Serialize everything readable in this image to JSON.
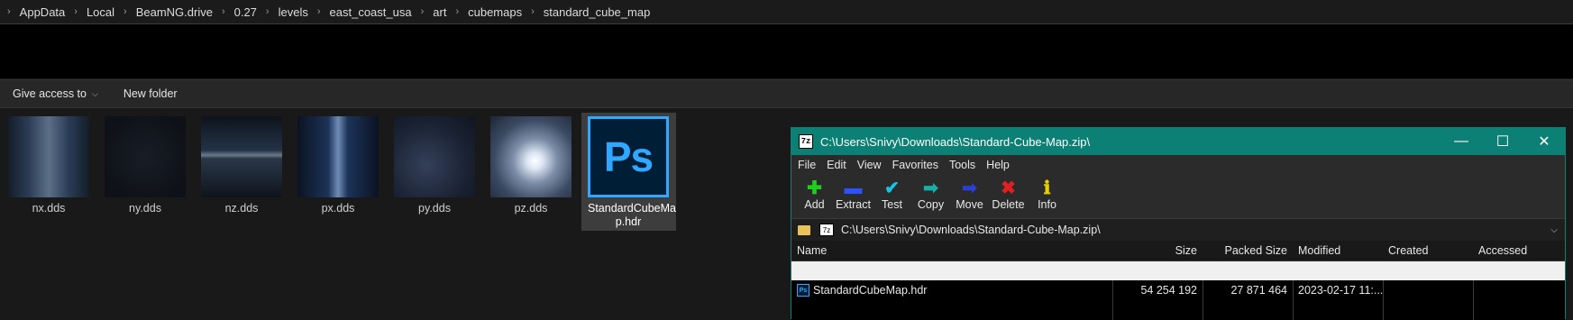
{
  "breadcrumb": [
    "AppData",
    "Local",
    "BeamNG.drive",
    "0.27",
    "levels",
    "east_coast_usa",
    "art",
    "cubemaps",
    "standard_cube_map"
  ],
  "toolbar": {
    "give_access": "Give access to",
    "new_folder": "New folder"
  },
  "files": [
    {
      "name": "nx.dds"
    },
    {
      "name": "ny.dds"
    },
    {
      "name": "nz.dds"
    },
    {
      "name": "px.dds"
    },
    {
      "name": "py.dds"
    },
    {
      "name": "pz.dds"
    }
  ],
  "hdr_file": {
    "name": "StandardCubeMa p.hdr",
    "icon_text": "Ps"
  },
  "sevenzip": {
    "title": "C:\\Users\\Snivy\\Downloads\\Standard-Cube-Map.zip\\",
    "icon_text": "7z",
    "window_buttons": {
      "minimize": "—",
      "maximize": "☐",
      "close": "✕"
    },
    "menus": [
      "File",
      "Edit",
      "View",
      "Favorites",
      "Tools",
      "Help"
    ],
    "tools": [
      {
        "label": "Add",
        "glyph": "✚",
        "color": "#1fcf1f"
      },
      {
        "label": "Extract",
        "glyph": "▬",
        "color": "#2a52ff"
      },
      {
        "label": "Test",
        "glyph": "✔",
        "color": "#19c2e6"
      },
      {
        "label": "Copy",
        "glyph": "➡",
        "color": "#15b0a8"
      },
      {
        "label": "Move",
        "glyph": "➡",
        "color": "#2a3fd0"
      },
      {
        "label": "Delete",
        "glyph": "✖",
        "color": "#e02020"
      },
      {
        "label": "Info",
        "glyph": "ℹ",
        "color": "#e6d200"
      }
    ],
    "address": "C:\\Users\\Snivy\\Downloads\\Standard-Cube-Map.zip\\",
    "columns": {
      "name": "Name",
      "size": "Size",
      "packed": "Packed Size",
      "modified": "Modified",
      "created": "Created",
      "accessed": "Accessed"
    },
    "rows": [
      {
        "name": "StandardCubeMap.hdr",
        "size": "54 254 192",
        "packed": "27 871 464",
        "modified": "2023-02-17 11:...",
        "created": "",
        "accessed": ""
      }
    ]
  }
}
